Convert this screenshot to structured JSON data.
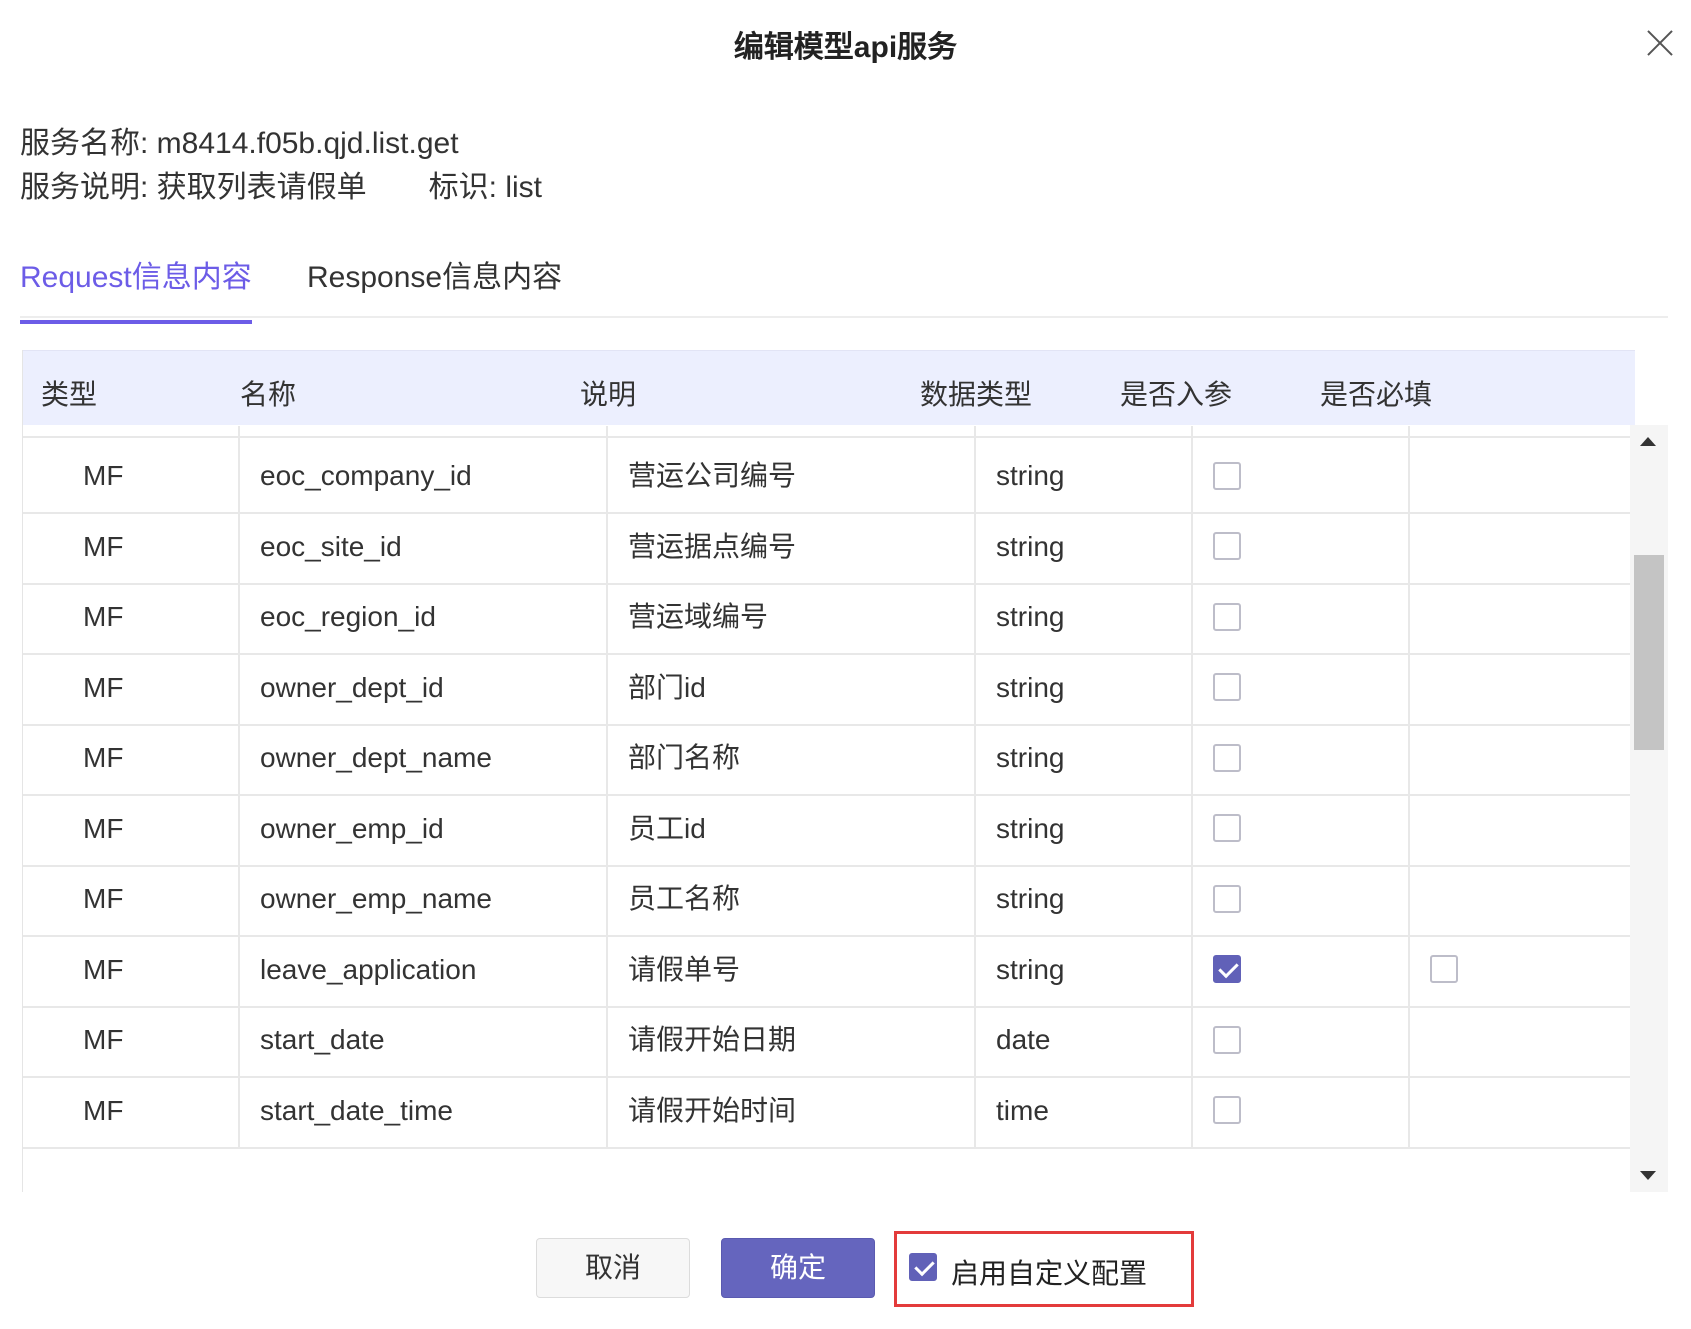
{
  "dialog": {
    "title": "编辑模型api服务",
    "service_name": "服务名称: m8414.f05b.qjd.list.get",
    "service_desc": "服务说明:  获取列表请假单",
    "identifier": "标识:  list"
  },
  "tabs": {
    "request": "Request信息内容",
    "response": "Response信息内容",
    "active": "request"
  },
  "table": {
    "headers": {
      "type": "类型",
      "name": "名称",
      "desc": "说明",
      "dtype": "数据类型",
      "param": "是否入参",
      "required": "是否必填"
    },
    "rows": [
      {
        "type": "MF",
        "name": "eoc_company_id",
        "desc": "营运公司编号",
        "dtype": "string",
        "param": false,
        "required": null
      },
      {
        "type": "MF",
        "name": "eoc_site_id",
        "desc": "营运据点编号",
        "dtype": "string",
        "param": false,
        "required": null
      },
      {
        "type": "MF",
        "name": "eoc_region_id",
        "desc": "营运域编号",
        "dtype": "string",
        "param": false,
        "required": null
      },
      {
        "type": "MF",
        "name": "owner_dept_id",
        "desc": "部门id",
        "dtype": "string",
        "param": false,
        "required": null
      },
      {
        "type": "MF",
        "name": "owner_dept_name",
        "desc": "部门名称",
        "dtype": "string",
        "param": false,
        "required": null
      },
      {
        "type": "MF",
        "name": "owner_emp_id",
        "desc": "员工id",
        "dtype": "string",
        "param": false,
        "required": null
      },
      {
        "type": "MF",
        "name": "owner_emp_name",
        "desc": "员工名称",
        "dtype": "string",
        "param": false,
        "required": null
      },
      {
        "type": "MF",
        "name": "leave_application",
        "desc": "请假单号",
        "dtype": "string",
        "param": true,
        "required": false
      },
      {
        "type": "MF",
        "name": "start_date",
        "desc": "请假开始日期",
        "dtype": "date",
        "param": false,
        "required": null
      },
      {
        "type": "MF",
        "name": "start_date_time",
        "desc": "请假开始时间",
        "dtype": "time",
        "param": false,
        "required": null
      }
    ]
  },
  "footer": {
    "cancel_label": "取消",
    "ok_label": "确定",
    "custom_config_label": "启用自定义配置",
    "custom_config_checked": true
  },
  "colors": {
    "accent": "#6c5ce7",
    "primary_button": "#6565be",
    "header_bg": "#eceffe",
    "highlight_border": "#e33b3b"
  },
  "icons": {
    "close": "close-icon",
    "scroll_up": "triangle-up-icon",
    "scroll_down": "triangle-down-icon",
    "check": "check-icon"
  }
}
